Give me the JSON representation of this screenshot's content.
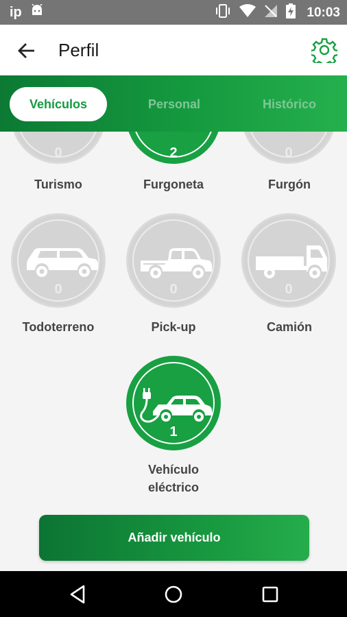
{
  "status_bar": {
    "left_text": "ip",
    "time": "10:03"
  },
  "header": {
    "title": "Perfil"
  },
  "tabs": [
    {
      "label": "Vehículos",
      "active": true
    },
    {
      "label": "Personal",
      "active": false
    },
    {
      "label": "Histórico",
      "active": false
    }
  ],
  "vehicles": [
    {
      "label": "Turismo",
      "count": "0",
      "icon": "car-icon"
    },
    {
      "label": "Furgoneta",
      "count": "2",
      "icon": "van-icon",
      "selected": true
    },
    {
      "label": "Furgón",
      "count": "0",
      "icon": "box-van-icon"
    },
    {
      "label": "Todoterreno",
      "count": "0",
      "icon": "suv-icon"
    },
    {
      "label": "Pick-up",
      "count": "0",
      "icon": "pickup-icon"
    },
    {
      "label": "Camión",
      "count": "0",
      "icon": "truck-icon"
    },
    {
      "label_line1": "Vehículo",
      "label_line2": "eléctrico",
      "count": "1",
      "icon": "electric-car-icon",
      "selected": true
    }
  ],
  "add_button": {
    "label": "Añadir vehículo"
  },
  "colors": {
    "brand_green": "#18a043",
    "brand_dark": "#0c7433",
    "inactive_circle": "#d4d4d4"
  }
}
